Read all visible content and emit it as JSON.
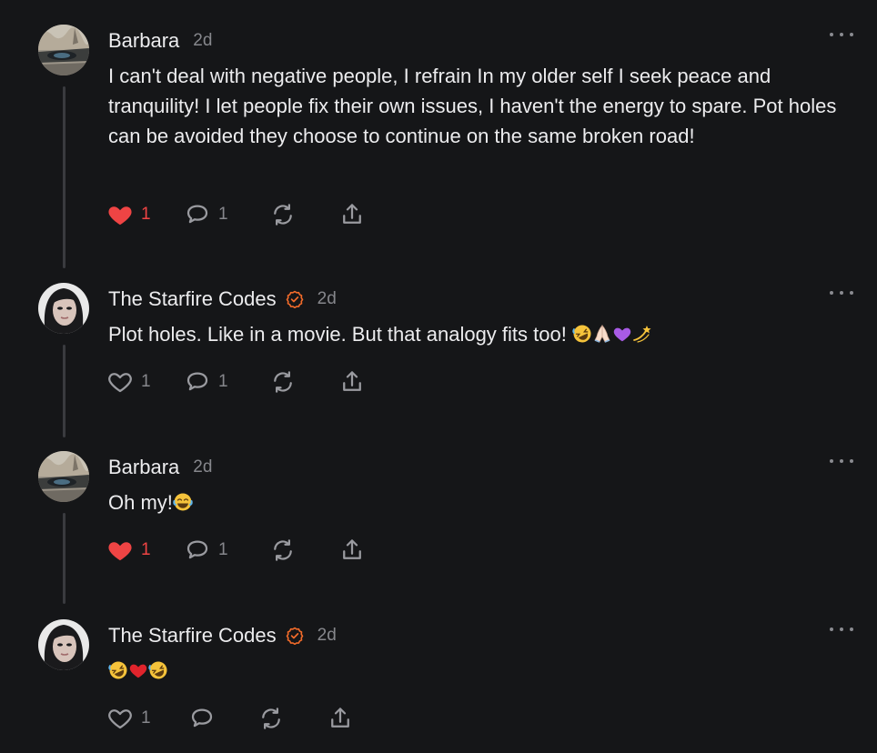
{
  "comments": [
    {
      "author": "Barbara",
      "verified": false,
      "time": "2d",
      "text": "I can't deal with negative people, I refrain In my older self I seek peace and tranquility! I let people fix their own issues, I haven't the energy to spare. Pot holes can be avoided they choose to continue on the same broken road!",
      "emoji": [],
      "liked": true,
      "like_count": "1",
      "reply_count": "1"
    },
    {
      "author": "The Starfire Codes",
      "verified": true,
      "time": "2d",
      "text": "Plot holes. Like in a movie. But that analogy fits too!",
      "emoji": [
        "rolling-laughing-emoji",
        "folded-hands-emoji",
        "purple-heart-emoji",
        "dizzy-emoji"
      ],
      "liked": false,
      "like_count": "1",
      "reply_count": "1"
    },
    {
      "author": "Barbara",
      "verified": false,
      "time": "2d",
      "text": "Oh my!",
      "emoji": [
        "tears-of-joy-emoji"
      ],
      "liked": true,
      "like_count": "1",
      "reply_count": "1"
    },
    {
      "author": "The Starfire Codes",
      "verified": true,
      "time": "2d",
      "text": "",
      "emoji": [
        "rolling-laughing-emoji",
        "red-heart-emoji",
        "rolling-laughing-emoji"
      ],
      "liked": false,
      "like_count": "1",
      "reply_count": ""
    }
  ],
  "icons": {
    "heart": "heart-icon",
    "reply": "comment-bubble-icon",
    "restack": "restack-icon",
    "share": "share-icon",
    "more": "more-options-icon",
    "verified": "verified-badge-icon"
  },
  "colors": {
    "background": "#151618",
    "text": "#ececee",
    "muted": "#86878c",
    "like": "#ef4444",
    "verified": "#f26b2a",
    "thread_line": "#3a3b3f"
  }
}
